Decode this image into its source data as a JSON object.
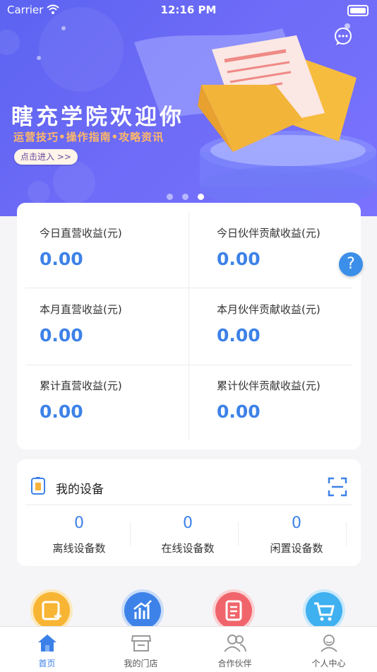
{
  "status_bar": {
    "carrier": "Carrier",
    "time": "12:16 PM"
  },
  "banner": {
    "title": "瞎充学院欢迎你",
    "subtitle": "运营技巧•操作指南•攻略资讯",
    "enter_button": "点击进入 >>"
  },
  "earnings": [
    {
      "label": "今日直营收益(元)",
      "value": "0.00"
    },
    {
      "label": "今日伙伴贡献收益(元)",
      "value": "0.00"
    },
    {
      "label": "本月直营收益(元)",
      "value": "0.00"
    },
    {
      "label": "本月伙伴贡献收益(元)",
      "value": "0.00"
    },
    {
      "label": "累计直营收益(元)",
      "value": "0.00"
    },
    {
      "label": "累计伙伴贡献收益(元)",
      "value": "0.00"
    }
  ],
  "help": {
    "label": "?"
  },
  "devices": {
    "title": "我的设备",
    "stats": [
      {
        "value": "0",
        "label": "离线设备数"
      },
      {
        "value": "0",
        "label": "在线设备数"
      },
      {
        "value": "0",
        "label": "闲置设备数"
      }
    ]
  },
  "tabbar": {
    "items": [
      {
        "label": "首页",
        "icon": "home-icon",
        "active": true
      },
      {
        "label": "我的门店",
        "icon": "store-icon",
        "active": false
      },
      {
        "label": "合作伙伴",
        "icon": "partners-icon",
        "active": false
      },
      {
        "label": "个人中心",
        "icon": "profile-icon",
        "active": false
      }
    ]
  },
  "colors": {
    "accent": "#3d82e8",
    "banner": "#6d6bf7",
    "orange": "#ffb869"
  }
}
